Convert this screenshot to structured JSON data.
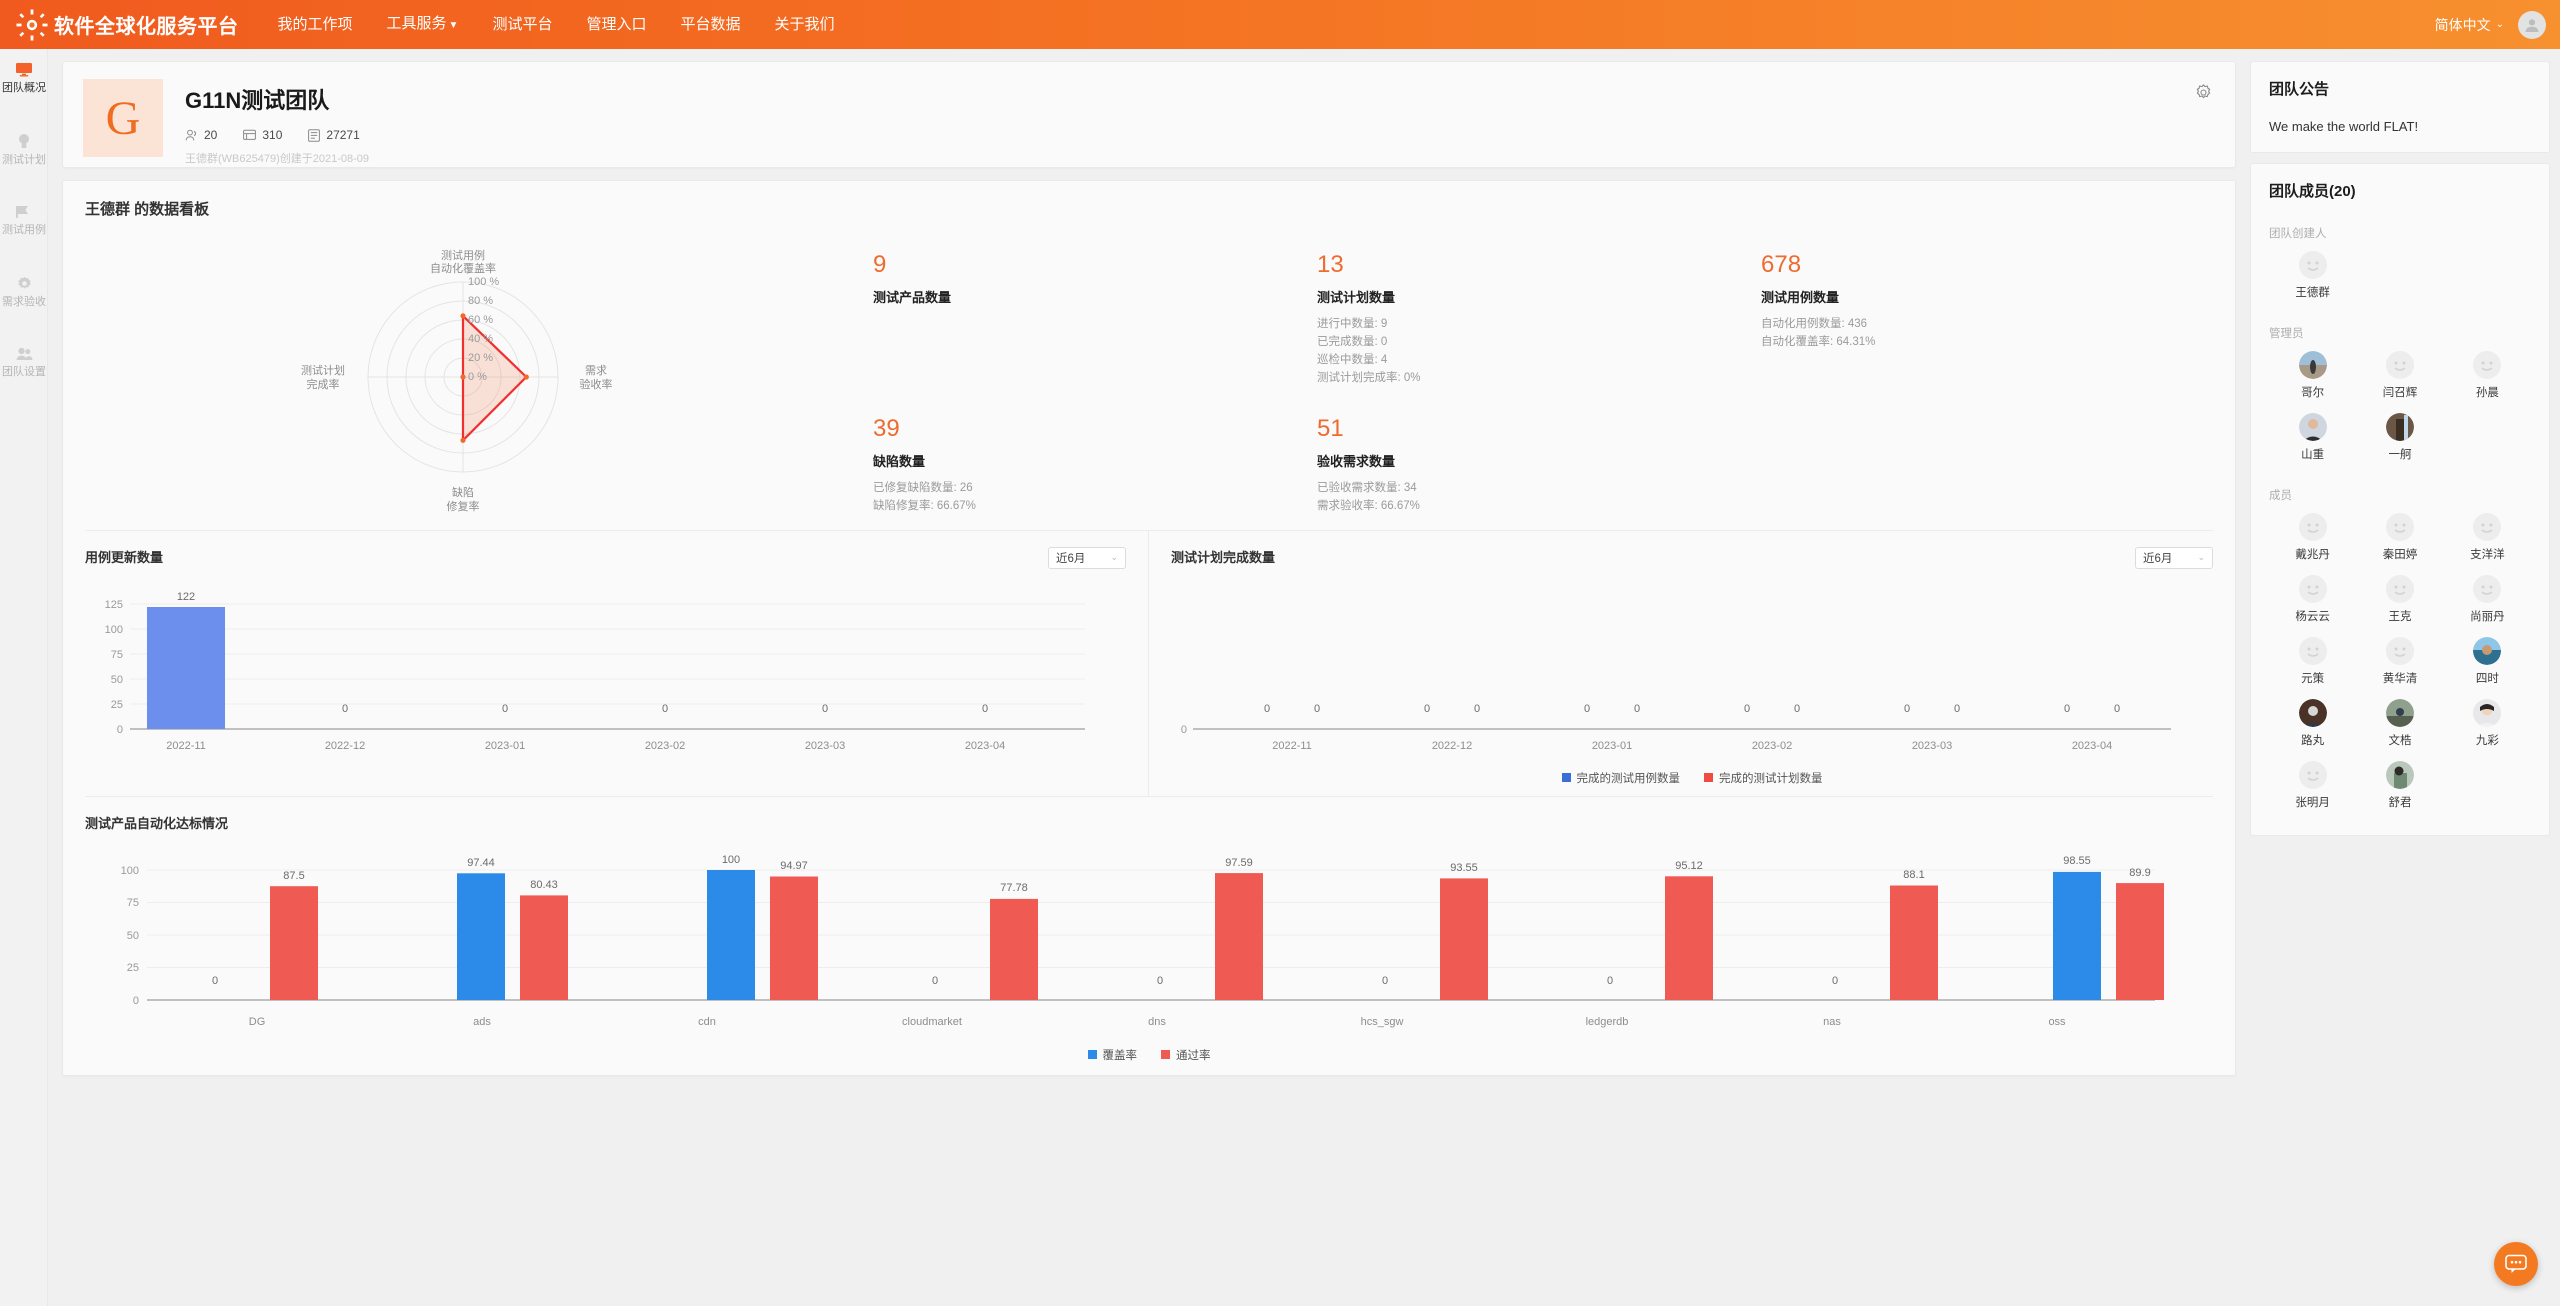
{
  "nav": {
    "brand": "软件全球化服务平台",
    "items": [
      {
        "label": "我的工作项",
        "caret": false
      },
      {
        "label": "工具服务",
        "caret": true
      },
      {
        "label": "测试平台",
        "caret": false
      },
      {
        "label": "管理入口",
        "caret": false
      },
      {
        "label": "平台数据",
        "caret": false
      },
      {
        "label": "关于我们",
        "caret": false
      }
    ],
    "language": "简体中文"
  },
  "rail": {
    "items": [
      {
        "label": "团队概况",
        "icon": "monitor-icon",
        "active": true
      },
      {
        "label": "测试计划",
        "icon": "bulb-icon",
        "active": false
      },
      {
        "label": "测试用例",
        "icon": "flag-icon",
        "active": false
      },
      {
        "label": "需求验收",
        "icon": "gear-icon",
        "active": false
      },
      {
        "label": "团队设置",
        "icon": "people-icon",
        "active": false
      }
    ]
  },
  "team": {
    "initial": "G",
    "name": "G11N测试团队",
    "stats": [
      {
        "icon": "members-icon",
        "value": "20"
      },
      {
        "icon": "card-icon",
        "value": "310"
      },
      {
        "icon": "doc-icon",
        "value": "27271"
      }
    ],
    "created_by": "王德群(WB625479)创建于2021-08-09"
  },
  "dashboard": {
    "title": "王德群 的数据看板",
    "kpis": [
      {
        "value": "9",
        "label": "测试产品数量",
        "subs": []
      },
      {
        "value": "13",
        "label": "测试计划数量",
        "subs": [
          "进行中数量: 9",
          "已完成数量: 0",
          "巡检中数量: 4",
          "测试计划完成率: 0%"
        ]
      },
      {
        "value": "678",
        "label": "测试用例数量",
        "subs": [
          "自动化用例数量: 436",
          "自动化覆盖率: 64.31%"
        ]
      },
      {
        "value": "39",
        "label": "缺陷数量",
        "subs": [
          "已修复缺陷数量: 26",
          "缺陷修复率: 66.67%"
        ]
      },
      {
        "value": "51",
        "label": "验收需求数量",
        "subs": [
          "已验收需求数量: 34",
          "需求验收率: 66.67%"
        ]
      }
    ]
  },
  "chart_data": [
    {
      "type": "radar",
      "title": "",
      "axes": [
        "测试用例\n自动化覆盖率",
        "需求\n验收率",
        "缺陷\n修复率",
        "测试计划\n完成率"
      ],
      "axis_labels": [
        "测试用例自动化覆盖率",
        "需求验收率",
        "缺陷修复率",
        "测试计划完成率"
      ],
      "tick_labels": [
        "0 %",
        "20 %",
        "40 %",
        "60 %",
        "80 %",
        "100 %"
      ],
      "ticks": [
        0,
        20,
        40,
        60,
        80,
        100
      ],
      "values": [
        64.31,
        66.67,
        66.67,
        0
      ],
      "series_color": "#f0302f",
      "fill_color": "rgba(240,110,60,0.18)",
      "rlim": [
        0,
        100
      ]
    },
    {
      "type": "bar",
      "title": "用例更新数量",
      "range_select": "近6月",
      "categories": [
        "2022-11",
        "2022-12",
        "2023-01",
        "2023-02",
        "2023-03",
        "2023-04"
      ],
      "values": [
        122,
        0,
        0,
        0,
        0,
        0
      ],
      "yticks": [
        0,
        25,
        50,
        75,
        100,
        125
      ],
      "ylim": [
        0,
        125
      ],
      "bar_color": "#6c8fee",
      "grid": true,
      "legend": null
    },
    {
      "type": "bar",
      "title": "测试计划完成数量",
      "range_select": "近6月",
      "categories": [
        "2022-11",
        "2022-12",
        "2023-01",
        "2023-02",
        "2023-03",
        "2023-04"
      ],
      "series": [
        {
          "name": "完成的测试用例数量",
          "values": [
            0,
            0,
            0,
            0,
            0,
            0
          ],
          "color": "#3a6fd8"
        },
        {
          "name": "完成的测试计划数量",
          "values": [
            0,
            0,
            0,
            0,
            0,
            0
          ],
          "color": "#ef4b42"
        }
      ],
      "yticks": [
        0
      ],
      "ylim": [
        0,
        1
      ],
      "legend": "bottom",
      "grid": false
    },
    {
      "type": "bar",
      "title": "测试产品自动化达标情况",
      "categories": [
        "DG",
        "ads",
        "cdn",
        "cloudmarket",
        "dns",
        "hcs_sgw",
        "ledgerdb",
        "nas",
        "oss"
      ],
      "series": [
        {
          "name": "覆盖率",
          "values": [
            0,
            97.44,
            100,
            0,
            0,
            0,
            0,
            0,
            98.55
          ],
          "color": "#2c8ae8"
        },
        {
          "name": "通过率",
          "values": [
            87.5,
            80.43,
            94.97,
            77.78,
            97.59,
            93.55,
            95.12,
            88.1,
            89.9
          ],
          "color": "#ef5a52"
        }
      ],
      "yticks": [
        0,
        25,
        50,
        75,
        100
      ],
      "ylim": [
        0,
        110
      ],
      "legend": "bottom",
      "grid": true
    }
  ],
  "announcement": {
    "title": "团队公告",
    "text": "We make the world FLAT!"
  },
  "members_panel": {
    "title": "团队成员(20)",
    "groups": [
      {
        "label": "团队创建人",
        "members": [
          {
            "name": "王德群",
            "avatar": "default"
          }
        ]
      },
      {
        "label": "管理员",
        "members": [
          {
            "name": "哥尔",
            "avatar": "photo-beach"
          },
          {
            "name": "闫召辉",
            "avatar": "default"
          },
          {
            "name": "孙晨",
            "avatar": "default"
          },
          {
            "name": "山重",
            "avatar": "photo-man"
          },
          {
            "name": "一舸",
            "avatar": "photo-dark"
          }
        ]
      },
      {
        "label": "成员",
        "members": [
          {
            "name": "戴兆丹",
            "avatar": "default"
          },
          {
            "name": "秦田婷",
            "avatar": "default"
          },
          {
            "name": "支洋洋",
            "avatar": "default"
          },
          {
            "name": "杨云云",
            "avatar": "default"
          },
          {
            "name": "王克",
            "avatar": "default"
          },
          {
            "name": "尚丽丹",
            "avatar": "default"
          },
          {
            "name": "元策",
            "avatar": "default"
          },
          {
            "name": "黄华清",
            "avatar": "default"
          },
          {
            "name": "四时",
            "avatar": "photo-sea"
          },
          {
            "name": "路丸",
            "avatar": "photo-brown"
          },
          {
            "name": "文梏",
            "avatar": "photo-rock"
          },
          {
            "name": "九彩",
            "avatar": "photo-girl"
          },
          {
            "name": "张明月",
            "avatar": "default"
          },
          {
            "name": "舒君",
            "avatar": "photo-green"
          }
        ]
      }
    ]
  },
  "chat": {
    "icon": "chat-icon"
  }
}
